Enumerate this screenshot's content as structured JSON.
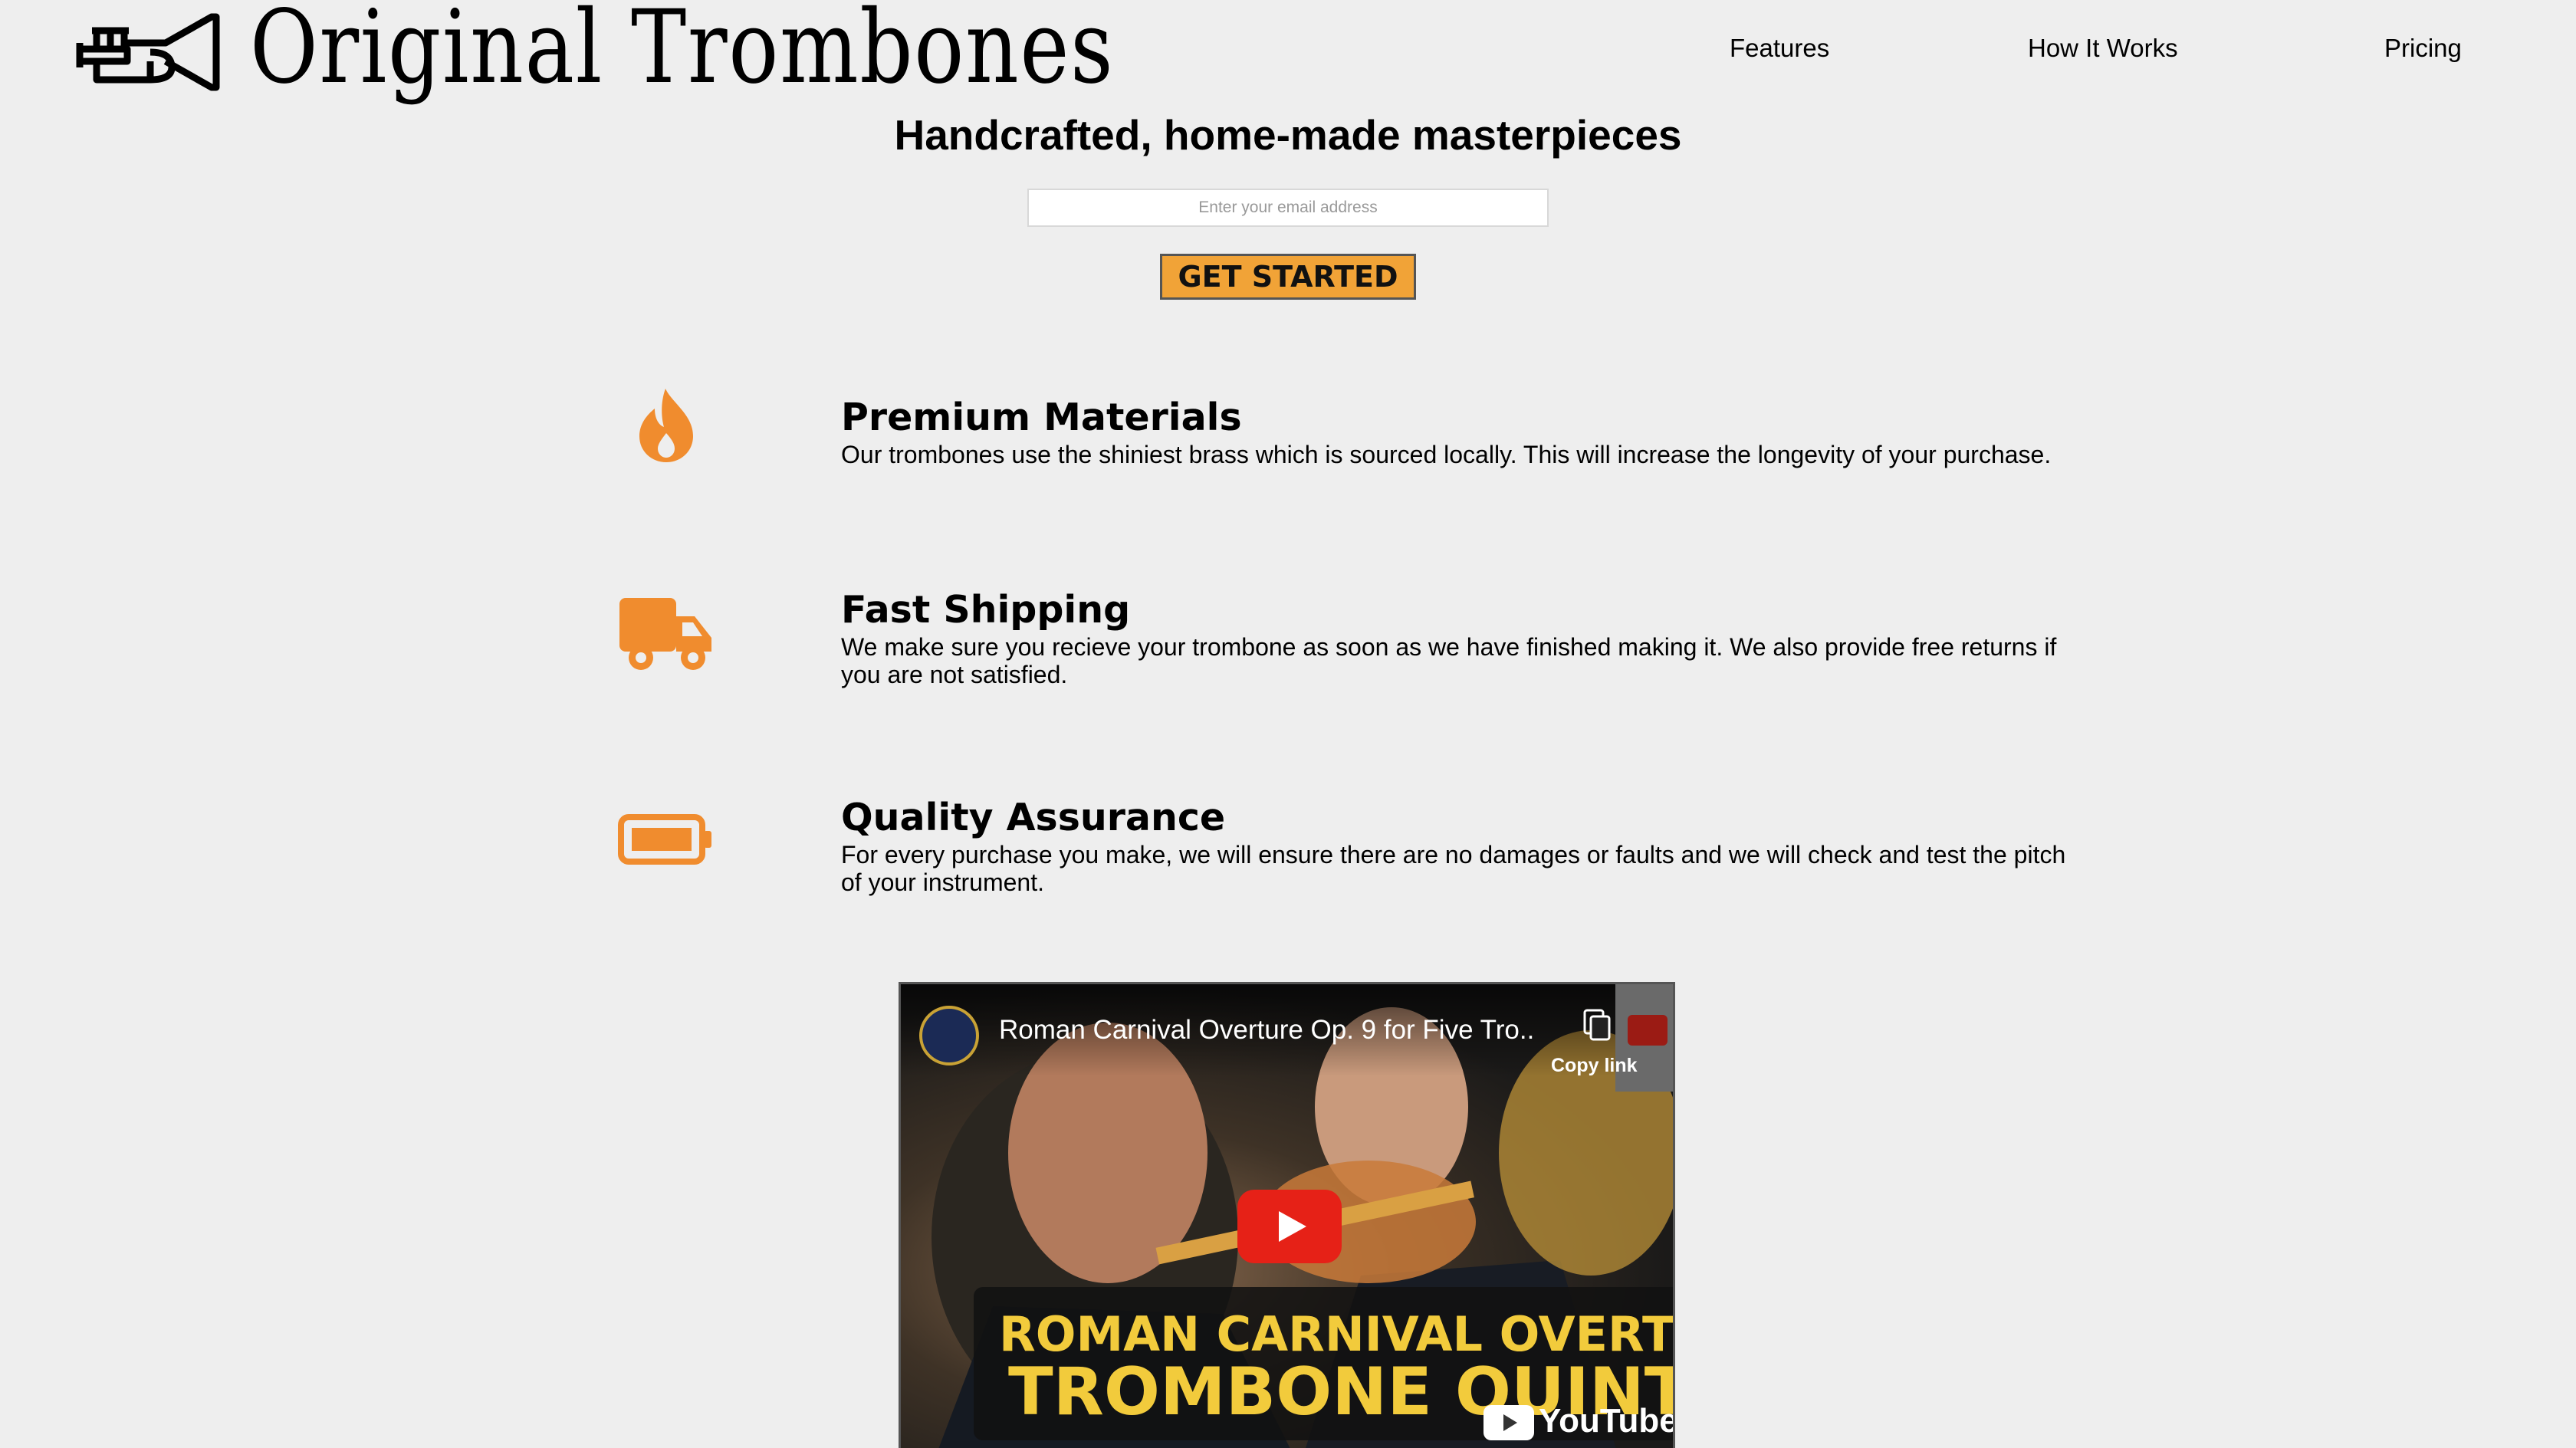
{
  "header": {
    "brand": "Original Trombones",
    "logo_icon": "trumpet-logo-icon",
    "nav": {
      "features": "Features",
      "how_it_works": "How It Works",
      "pricing": "Pricing"
    }
  },
  "hero": {
    "title": "Handcrafted, home-made masterpieces",
    "email_placeholder": "Enter your email address",
    "cta_label": "GET STARTED"
  },
  "features": [
    {
      "icon": "fire-icon",
      "title": "Premium Materials",
      "description": "Our trombones use the shiniest brass which is sourced locally. This will increase the longevity of your purchase."
    },
    {
      "icon": "truck-icon",
      "title": "Fast Shipping",
      "description": "We make sure you recieve your trombone as soon as we have finished making it. We also provide free returns if you are not satisfied."
    },
    {
      "icon": "battery-icon",
      "title": "Quality Assurance",
      "description": "For every purchase you make, we will ensure there are no damages or faults and we will check and test the pitch of your instrument."
    }
  ],
  "video": {
    "title": "Roman Carnival Overture Op. 9 for Five Tro...",
    "copy_link": "Copy link",
    "banner_line1": "ROMAN CARNIVAL OVERTURE",
    "banner_line2": "TROMBONE QUINTET",
    "platform": "YouTube"
  },
  "colors": {
    "background": "#eeeeee",
    "accent": "#f1a337",
    "icon_orange": "#f08c2e",
    "play_red": "#e62117",
    "banner_yellow": "#f2cb3c"
  }
}
